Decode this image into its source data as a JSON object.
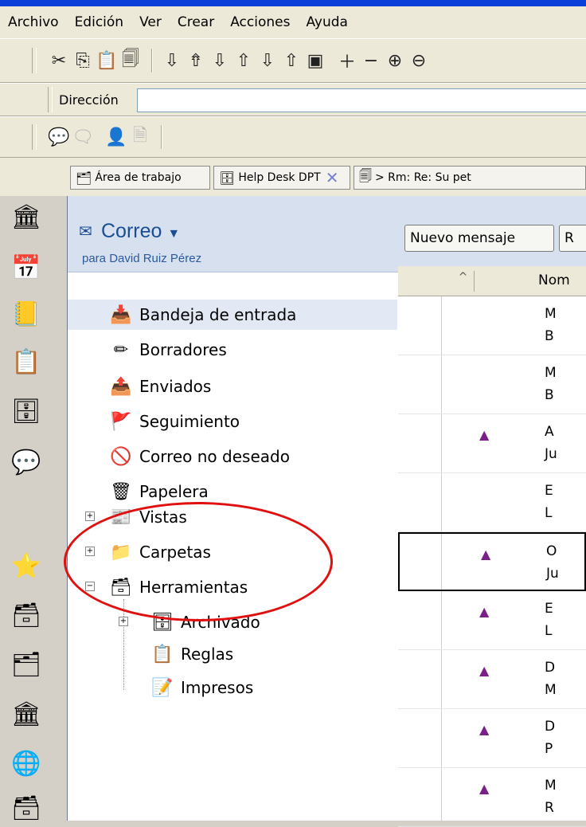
{
  "menu": [
    "Archivo",
    "Edición",
    "Ver",
    "Crear",
    "Acciones",
    "Ayuda"
  ],
  "toolbar_icons": [
    "scissors-icon",
    "copy-icon",
    "paste-icon",
    "clipboard-icon",
    "move-down-icon",
    "move-up-top-icon",
    "down-arrow-icon",
    "up-arrow-icon",
    "star-down-icon",
    "star-up-icon",
    "calendar-arrow-icon",
    "plus-icon",
    "minus-icon",
    "expand-icon",
    "collapse-icon"
  ],
  "address": {
    "label": "Dirección",
    "value": ""
  },
  "tabs": [
    {
      "label": "Área de trabajo"
    },
    {
      "label": "Help Desk DPT"
    },
    {
      "label": "> Rm: Re: Su pet"
    }
  ],
  "mail": {
    "title": "Correo",
    "subtitle": "para David Ruiz Pérez",
    "folders": [
      {
        "label": "Bandeja de entrada"
      },
      {
        "label": "Borradores"
      },
      {
        "label": "Enviados"
      },
      {
        "label": "Seguimiento"
      },
      {
        "label": "Correo no deseado"
      },
      {
        "label": "Papelera"
      },
      {
        "label": "Vistas"
      },
      {
        "label": "Carpetas"
      },
      {
        "label": "Herramientas"
      },
      {
        "label": "Archivado"
      },
      {
        "label": "Reglas"
      },
      {
        "label": "Impresos"
      }
    ]
  },
  "actions": {
    "new_message": "Nuevo mensaje",
    "reply": "R"
  },
  "columns": {
    "sort_arrow": "^",
    "name": "Nom"
  },
  "rows": [
    {
      "l1": "M",
      "l2": "B"
    },
    {
      "l1": "M",
      "l2": "B"
    },
    {
      "l1": "A",
      "l2": "Ju"
    },
    {
      "l1": "E",
      "l2": "L"
    },
    {
      "l1": "O",
      "l2": "Ju"
    },
    {
      "l1": "E",
      "l2": "L"
    },
    {
      "l1": "D",
      "l2": "M"
    },
    {
      "l1": "D",
      "l2": "P"
    },
    {
      "l1": "M",
      "l2": "R"
    }
  ]
}
